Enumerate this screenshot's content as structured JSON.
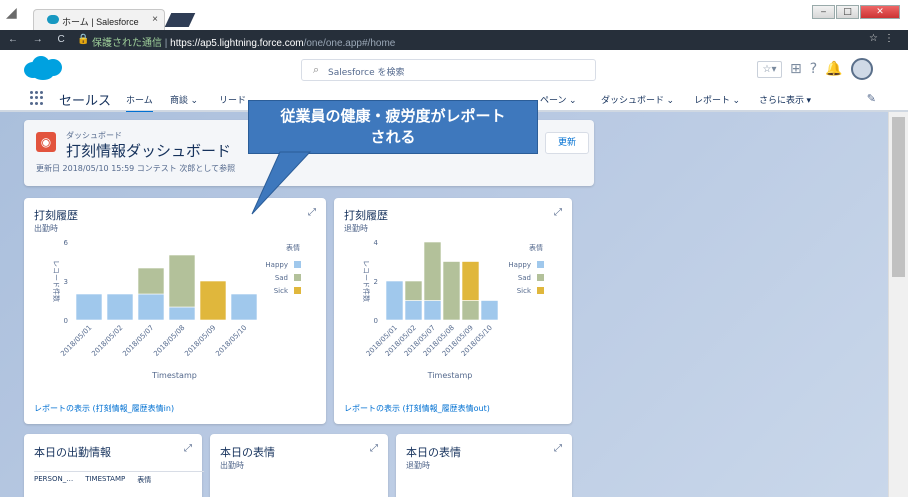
{
  "browser": {
    "tab_title": "ホーム | Salesforce",
    "tab_close": "×",
    "url_secure": "保護された通信",
    "url_sep": "|",
    "url_host": "https://ap5.lightning.force.com",
    "url_path": "/one/one.app#/home",
    "window_buttons": [
      "‒",
      "□",
      "✕"
    ]
  },
  "header": {
    "search_placeholder": "Salesforce を検索"
  },
  "nav": {
    "app_name": "セールス",
    "items": [
      {
        "label": "ホーム",
        "active": true
      },
      {
        "label": "商談 ⌄"
      },
      {
        "label": "リード"
      },
      {
        "label": "ペーン ⌄"
      },
      {
        "label": "ダッシュボード ⌄"
      },
      {
        "label": "レポート ⌄"
      },
      {
        "label": "さらに表示 ▾"
      }
    ]
  },
  "dashboard": {
    "subtitle": "ダッシュボード",
    "title": "打刻情報ダッシュボード",
    "meta": "更新日 2018/05/10 15:59 コンテスト 次郎として参照",
    "refresh_label": "更新"
  },
  "callout": {
    "line1": "従業員の健康・疲労度がレポート",
    "line2": "される"
  },
  "charts": [
    {
      "title": "打刻履歴",
      "subtitle": "出勤時",
      "link": "レポートの表示 (打刻情報_履歴表情in)"
    },
    {
      "title": "打刻履歴",
      "subtitle": "退勤時",
      "link": "レポートの表示 (打刻情報_履歴表情out)"
    }
  ],
  "chart_data": [
    {
      "type": "bar",
      "stacked": true,
      "categories": [
        "2018/05/01",
        "2018/05/02",
        "2018/05/07",
        "2018/05/08",
        "2018/05/09",
        "2018/05/10"
      ],
      "series": [
        {
          "name": "Happy",
          "values": [
            2,
            2,
            2,
            1,
            0,
            2
          ],
          "color": "#a0c8ec"
        },
        {
          "name": "Sad",
          "values": [
            0,
            0,
            2,
            4,
            0,
            0
          ],
          "color": "#b3c19a"
        },
        {
          "name": "Sick",
          "values": [
            0,
            0,
            0,
            0,
            3,
            0
          ],
          "color": "#e0b73c"
        }
      ],
      "legend_title": "表情",
      "xlabel": "Timestamp",
      "ylabel": "レコード件数",
      "yticks": [
        0,
        3,
        6
      ],
      "ylim": [
        0,
        6
      ]
    },
    {
      "type": "bar",
      "stacked": true,
      "categories": [
        "2018/05/01",
        "2018/05/02",
        "2018/05/07",
        "2018/05/08",
        "2018/05/09",
        "2018/05/10"
      ],
      "series": [
        {
          "name": "Happy",
          "values": [
            2,
            1,
            1,
            0,
            0,
            1
          ],
          "color": "#a0c8ec"
        },
        {
          "name": "Sad",
          "values": [
            0,
            1,
            3,
            3,
            1,
            0
          ],
          "color": "#b3c19a"
        },
        {
          "name": "Sick",
          "values": [
            0,
            0,
            0,
            0,
            2,
            0
          ],
          "color": "#e0b73c"
        }
      ],
      "legend_title": "表情",
      "xlabel": "Timestamp",
      "ylabel": "レコード件数",
      "yticks": [
        0,
        2,
        4
      ],
      "ylim": [
        0,
        4
      ]
    }
  ],
  "bottom_cards": [
    {
      "title": "本日の出勤情報",
      "columns": [
        "PERSON_…",
        "TIMESTAMP",
        "表情"
      ]
    },
    {
      "title": "本日の表情",
      "subtitle": "出勤時"
    },
    {
      "title": "本日の表情",
      "subtitle": "退勤時"
    }
  ]
}
